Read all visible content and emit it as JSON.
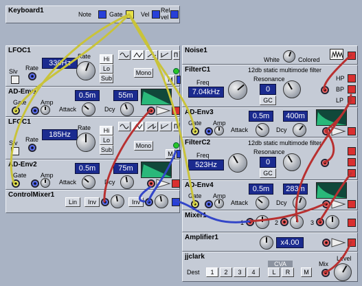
{
  "keyboard": {
    "title": "Keyboard1",
    "note": "Note",
    "gate": "Gate",
    "vel": "Vel",
    "relvel": "Rel\nvel"
  },
  "lfoc1a": {
    "title": "LFOC1",
    "rate_label": "Rate",
    "rate": "330Hz",
    "hi": "Hi",
    "lo": "Lo",
    "sub": "Sub",
    "mono": "Mono",
    "slv": "Slv",
    "m": "M"
  },
  "adenv1": {
    "title": "AD-Env1",
    "gate": "Gate",
    "amp": "Amp",
    "attack_label": "Attack",
    "attack": "0.5m",
    "decay_label": "Dcy",
    "decay": "55m"
  },
  "lfoc1b": {
    "title": "LFOC1",
    "rate_label": "Rate",
    "rate": "185Hz",
    "hi": "Hi",
    "lo": "Lo",
    "sub": "Sub",
    "mono": "Mono",
    "slv": "Slv",
    "m": "M"
  },
  "adenv2": {
    "title": "AD-Env2",
    "gate": "Gate",
    "amp": "Amp",
    "attack_label": "Attack",
    "attack": "0.5m",
    "decay_label": "Dcy",
    "decay": "75m"
  },
  "controlmixer": {
    "title": "ControlMixer1",
    "lin": "Lin",
    "inv1": "Inv",
    "inv2": "Inv"
  },
  "noise": {
    "title": "Noise1",
    "white": "White",
    "colored": "Colored"
  },
  "filterc1": {
    "title": "FilterC1",
    "desc": "12db static multimode filter",
    "freq_label": "Freq",
    "freq": "7.04kHz",
    "res_label": "Resonance",
    "res": "0",
    "gc": "GC",
    "hp": "HP",
    "bp": "BP",
    "lp": "LP"
  },
  "adenv3": {
    "title": "AD-Env3",
    "gate": "Gate",
    "amp": "Amp",
    "attack_label": "Attack",
    "attack": "0.5m",
    "decay_label": "Dcy",
    "decay": "400m"
  },
  "filterc2": {
    "title": "FilterC2",
    "desc": "12db static multimode filter",
    "freq_label": "Freq",
    "freq": "523Hz",
    "res_label": "Resonance",
    "res": "0",
    "gc": "GC"
  },
  "adenv4": {
    "title": "AD-Env4",
    "gate": "Gate",
    "amp": "Amp",
    "attack_label": "Attack",
    "attack": "0.5m",
    "decay_label": "Dcy",
    "decay": "283m"
  },
  "mixer": {
    "title": "Mixer1",
    "ch1": "1",
    "ch2": "2",
    "ch3": "3"
  },
  "amplifier": {
    "title": "Amplifier1",
    "gain": "x4.00"
  },
  "jjclark": {
    "title": "jjclark",
    "dest": "Dest",
    "d1": "1",
    "d2": "2",
    "d3": "3",
    "d4": "4",
    "l": "L",
    "r": "R",
    "m": "M",
    "cva": "CVA",
    "mix": "Mix",
    "level": "Level"
  },
  "colors": {
    "background": "#a9b3c4",
    "panel": "#c5cbd6",
    "display": "#1b2b8f",
    "cable_yellow": "#d8d23a",
    "cable_red": "#c83030",
    "cable_blue": "#3a4ad8"
  }
}
